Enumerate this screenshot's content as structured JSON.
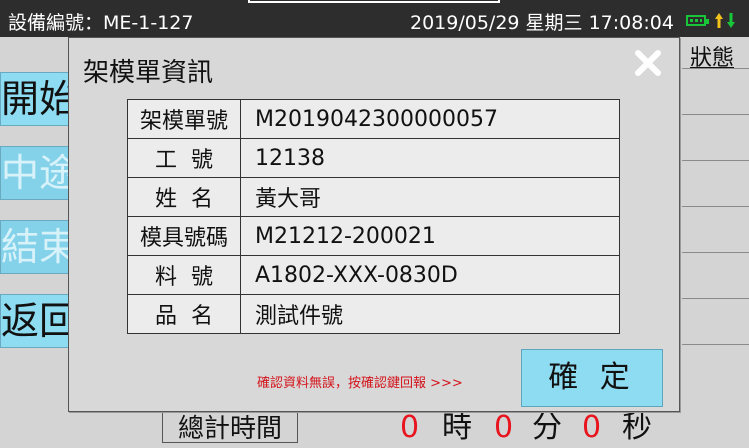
{
  "status_bar": {
    "device_label": "設備編號：ME-1-127",
    "datetime": "2019/05/29 星期三 17:08:04"
  },
  "side_buttons": [
    {
      "label": "開始"
    },
    {
      "label": "中途"
    },
    {
      "label": "結束"
    },
    {
      "label": "返回"
    }
  ],
  "background": {
    "status_header": "狀態",
    "total_time_label": "總計時間",
    "hours_value": "0",
    "hours_unit": "時",
    "minutes_value": "0",
    "minutes_unit": "分",
    "seconds_value": "0",
    "seconds_unit": "秒"
  },
  "dialog": {
    "title": "架模單資訊",
    "rows": [
      {
        "key": "架模單號",
        "value": "M2019042300000057"
      },
      {
        "key": "工  號",
        "value": "12138"
      },
      {
        "key": "姓  名",
        "value": "黃大哥"
      },
      {
        "key": "模具號碼",
        "value": "M21212-200021"
      },
      {
        "key": "料  號",
        "value": "A1802-XXX-0830D"
      },
      {
        "key": "品  名",
        "value": "測試件號"
      }
    ],
    "hint": "確認資料無誤，按確認鍵回報 >>>",
    "confirm_label": "確 定"
  },
  "colors": {
    "accent_button": "#8edcf2",
    "hint_text": "#d4141b",
    "battery_green": "#19c63a"
  },
  "icons": [
    "battery-icon",
    "signal-arrows-icon",
    "close-icon"
  ]
}
